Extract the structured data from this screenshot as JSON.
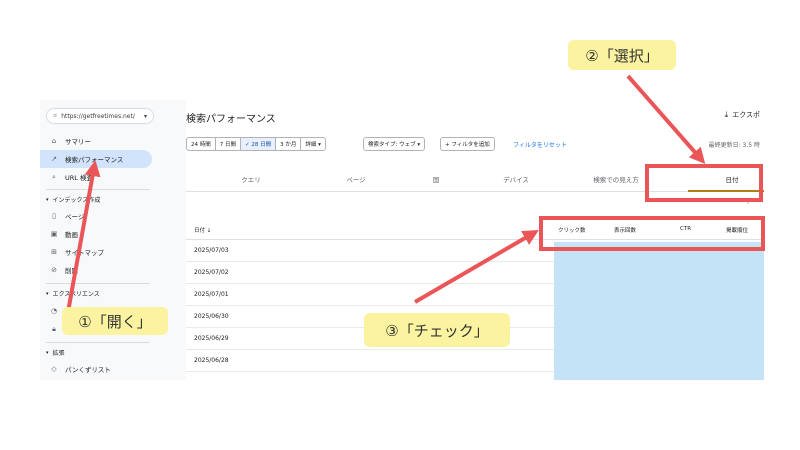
{
  "sidebar": {
    "property": "https://getfreetimes.net/",
    "items": [
      {
        "icon": "home-icon",
        "glyph": "⌂",
        "label": "サマリー"
      },
      {
        "icon": "trend-icon",
        "glyph": "↗",
        "label": "検索パフォーマンス"
      },
      {
        "icon": "search-icon",
        "glyph": "⌕",
        "label": "URL 検査"
      }
    ],
    "index_section": "インデックス作成",
    "index_items": [
      {
        "icon": "page-icon",
        "glyph": "▯",
        "label": "ページ"
      },
      {
        "icon": "video-icon",
        "glyph": "▣",
        "label": "動画"
      },
      {
        "icon": "sitemap-icon",
        "glyph": "⊞",
        "label": "サイトマップ"
      },
      {
        "icon": "remove-icon",
        "glyph": "⊘",
        "label": "削除"
      }
    ],
    "experience_section": "エクスペリエンス",
    "extensions_section": "拡張",
    "extensions_item": "パンくずリスト"
  },
  "main": {
    "title": "検索パフォーマンス",
    "export": "エクスポ",
    "date_chips": [
      "24 時間",
      "7 日間",
      "✓ 28 日間",
      "3 か月",
      "詳細 ▾"
    ],
    "search_type": "検索タイプ: ウェブ ▾",
    "add_filter": "+ フィルタを追加",
    "reset_filter": "フィルタをリセット",
    "updated": "最終更新日: 3.5 時",
    "tabs": [
      "クエリ",
      "ページ",
      "国",
      "デバイス",
      "検索での見え方",
      "日付"
    ],
    "columns": {
      "date": "日付 ↓",
      "clicks": "クリック数",
      "impressions": "表示回数",
      "ctr": "CTR",
      "position": "掲載順位"
    },
    "rows": [
      "2025/07/03",
      "2025/07/02",
      "2025/07/01",
      "2025/06/30",
      "2025/06/29",
      "2025/06/28"
    ]
  },
  "annotations": {
    "open": "①「開く」",
    "select": "②「選択」",
    "check": "③「チェック」"
  },
  "colors": {
    "annotation_red": "#ea5658",
    "callout_yellow": "#fbf3a0",
    "data_blue": "#c5e3f6",
    "active_nav": "#d2e3fc"
  }
}
